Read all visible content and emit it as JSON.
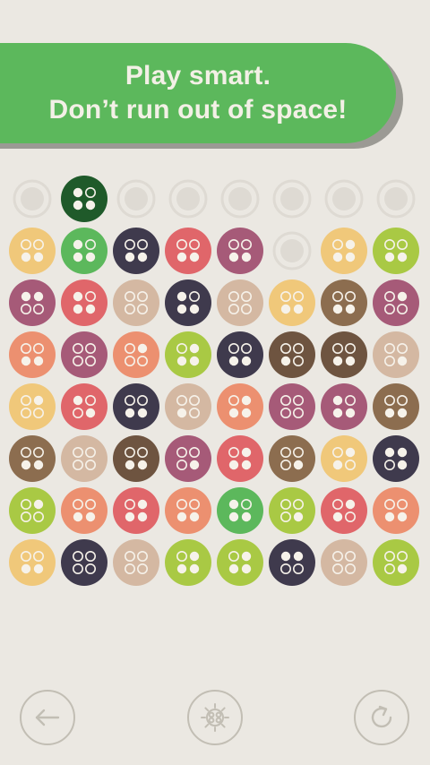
{
  "banner": {
    "line1": "Play smart.",
    "line2": "Don’t run out of space!"
  },
  "colors": {
    "background": "#ebe8e2",
    "banner": "#5cb85c",
    "banner_text": "#f3f0e6",
    "empty_slot": "#dedad3",
    "button_outline": "#c2beb4",
    "pieces": {
      "yellow": "#f0c87a",
      "green": "#5cb85c",
      "dark_green": "#1f5a2a",
      "navy": "#3f3a4d",
      "red": "#e0666a",
      "purple": "#a65a78",
      "lime": "#a9c944",
      "tan": "#d4b8a2",
      "brown": "#8c6d4f",
      "salmon": "#ec9070",
      "dark_brown": "#6e5440"
    }
  },
  "board": {
    "rows": [
      [
        {
          "c": "empty"
        },
        {
          "c": "dark_green",
          "p": [
            1,
            0,
            1,
            1
          ]
        },
        {
          "c": "empty"
        },
        {
          "c": "empty"
        },
        {
          "c": "empty"
        },
        {
          "c": "empty"
        },
        {
          "c": "empty"
        },
        {
          "c": "empty"
        }
      ],
      [
        {
          "c": "yellow",
          "p": [
            0,
            0,
            1,
            1
          ]
        },
        {
          "c": "green",
          "p": [
            1,
            0,
            1,
            1
          ]
        },
        {
          "c": "navy",
          "p": [
            0,
            0,
            1,
            1
          ]
        },
        {
          "c": "red",
          "p": [
            0,
            0,
            1,
            1
          ]
        },
        {
          "c": "purple",
          "p": [
            0,
            0,
            1,
            1
          ]
        },
        {
          "c": "empty"
        },
        {
          "c": "yellow",
          "p": [
            0,
            1,
            1,
            1
          ]
        },
        {
          "c": "lime",
          "p": [
            0,
            0,
            1,
            1
          ]
        }
      ],
      [
        {
          "c": "purple",
          "p": [
            1,
            1,
            0,
            0
          ]
        },
        {
          "c": "red",
          "p": [
            1,
            0,
            1,
            1
          ]
        },
        {
          "c": "tan",
          "p": [
            0,
            0,
            0,
            0
          ]
        },
        {
          "c": "navy",
          "p": [
            1,
            0,
            1,
            1
          ]
        },
        {
          "c": "tan",
          "p": [
            0,
            0,
            0,
            0
          ]
        },
        {
          "c": "yellow",
          "p": [
            0,
            0,
            1,
            1
          ]
        },
        {
          "c": "brown",
          "p": [
            0,
            0,
            1,
            1
          ]
        },
        {
          "c": "purple",
          "p": [
            0,
            1,
            0,
            0
          ]
        }
      ],
      [
        {
          "c": "salmon",
          "p": [
            0,
            0,
            1,
            1
          ]
        },
        {
          "c": "purple",
          "p": [
            0,
            0,
            0,
            0
          ]
        },
        {
          "c": "salmon",
          "p": [
            0,
            1,
            0,
            0
          ]
        },
        {
          "c": "lime",
          "p": [
            0,
            1,
            1,
            1
          ]
        },
        {
          "c": "navy",
          "p": [
            0,
            0,
            1,
            1
          ]
        },
        {
          "c": "dark_brown",
          "p": [
            0,
            0,
            1,
            0
          ]
        },
        {
          "c": "dark_brown",
          "p": [
            0,
            0,
            1,
            1
          ]
        },
        {
          "c": "tan",
          "p": [
            0,
            0,
            0,
            1
          ]
        }
      ],
      [
        {
          "c": "yellow",
          "p": [
            0,
            1,
            0,
            0
          ]
        },
        {
          "c": "red",
          "p": [
            1,
            0,
            0,
            1
          ]
        },
        {
          "c": "navy",
          "p": [
            0,
            0,
            1,
            1
          ]
        },
        {
          "c": "tan",
          "p": [
            0,
            0,
            1,
            0
          ]
        },
        {
          "c": "salmon",
          "p": [
            0,
            1,
            1,
            1
          ]
        },
        {
          "c": "purple",
          "p": [
            0,
            0,
            0,
            0
          ]
        },
        {
          "c": "purple",
          "p": [
            1,
            0,
            1,
            1
          ]
        },
        {
          "c": "brown",
          "p": [
            0,
            0,
            1,
            1
          ]
        }
      ],
      [
        {
          "c": "brown",
          "p": [
            0,
            0,
            1,
            1
          ]
        },
        {
          "c": "tan",
          "p": [
            0,
            0,
            0,
            0
          ]
        },
        {
          "c": "dark_brown",
          "p": [
            0,
            0,
            1,
            1
          ]
        },
        {
          "c": "purple",
          "p": [
            0,
            0,
            0,
            1
          ]
        },
        {
          "c": "red",
          "p": [
            0,
            1,
            1,
            1
          ]
        },
        {
          "c": "brown",
          "p": [
            0,
            0,
            0,
            1
          ]
        },
        {
          "c": "yellow",
          "p": [
            0,
            1,
            1,
            0
          ]
        },
        {
          "c": "navy",
          "p": [
            1,
            1,
            0,
            1
          ]
        }
      ],
      [
        {
          "c": "lime",
          "p": [
            0,
            1,
            0,
            0
          ]
        },
        {
          "c": "salmon",
          "p": [
            0,
            0,
            1,
            1
          ]
        },
        {
          "c": "red",
          "p": [
            0,
            1,
            1,
            1
          ]
        },
        {
          "c": "salmon",
          "p": [
            0,
            0,
            1,
            1
          ]
        },
        {
          "c": "green",
          "p": [
            1,
            0,
            1,
            1
          ]
        },
        {
          "c": "lime",
          "p": [
            0,
            0,
            0,
            1
          ]
        },
        {
          "c": "red",
          "p": [
            0,
            1,
            1,
            0
          ]
        },
        {
          "c": "salmon",
          "p": [
            0,
            0,
            1,
            1
          ]
        }
      ],
      [
        {
          "c": "yellow",
          "p": [
            0,
            0,
            1,
            1
          ]
        },
        {
          "c": "navy",
          "p": [
            0,
            0,
            0,
            0
          ]
        },
        {
          "c": "tan",
          "p": [
            0,
            0,
            0,
            0
          ]
        },
        {
          "c": "lime",
          "p": [
            0,
            1,
            1,
            1
          ]
        },
        {
          "c": "lime",
          "p": [
            0,
            1,
            1,
            1
          ]
        },
        {
          "c": "navy",
          "p": [
            1,
            1,
            0,
            0
          ]
        },
        {
          "c": "tan",
          "p": [
            0,
            0,
            0,
            0
          ]
        },
        {
          "c": "lime",
          "p": [
            0,
            0,
            0,
            1
          ]
        }
      ]
    ]
  },
  "controls": {
    "back_icon": "arrow-left-icon",
    "settings_icon": "gear-icon",
    "restart_icon": "restart-icon"
  }
}
